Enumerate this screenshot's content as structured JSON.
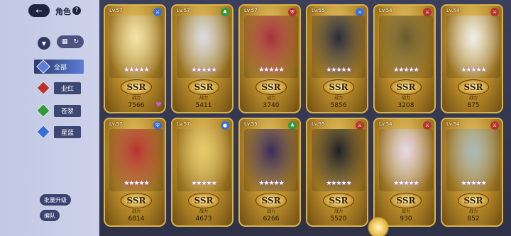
{
  "header": {
    "title": "角色",
    "help": "?",
    "back_glyph": "←"
  },
  "toolbar": {
    "filter_glyph": "▼",
    "grid_glyph": "▦",
    "refresh_glyph": "↻"
  },
  "categories": [
    {
      "label": "全部",
      "color": "#5c7ed4",
      "active": true
    },
    {
      "label": "业红",
      "color": "#b8322f",
      "active": false
    },
    {
      "label": "苍翠",
      "color": "#2f9a3a",
      "active": false
    },
    {
      "label": "星蓝",
      "color": "#3a6ed4",
      "active": false
    }
  ],
  "bottom_buttons": {
    "batch_upgrade": "批量升级",
    "formation": "编队"
  },
  "cards": [
    {
      "level": "Lv.57",
      "rarity": "SSR",
      "power_label": "战力",
      "power": "7566",
      "element_color": "#3a6ed4",
      "element_icon": "sword-icon",
      "heart": true,
      "portrait_color": "#f4e3a8"
    },
    {
      "level": "Lv.57",
      "rarity": "SSR",
      "power_label": "战力",
      "power": "5411",
      "element_color": "#2f9a3a",
      "element_icon": "leaf-icon",
      "heart": false,
      "portrait_color": "#d9dbe4"
    },
    {
      "level": "Lv.57",
      "rarity": "SSR",
      "power_label": "战力",
      "power": "3740",
      "element_color": "#b8322f",
      "element_icon": "shield-icon",
      "heart": false,
      "portrait_color": "#a8303c"
    },
    {
      "level": "Lv.55",
      "rarity": "SSR",
      "power_label": "战力",
      "power": "5856",
      "element_color": "#3a6ed4",
      "element_icon": "sword-icon",
      "heart": false,
      "portrait_color": "#2a2a3a"
    },
    {
      "level": "Lv.54",
      "rarity": "SSR",
      "power_label": "战力",
      "power": "3208",
      "element_color": "#b8322f",
      "element_icon": "sword-icon",
      "heart": false,
      "portrait_color": "#6a5a2a"
    },
    {
      "level": "Lv.54",
      "rarity": "SSR",
      "power_label": "战力",
      "power": "875",
      "element_color": "#b8322f",
      "element_icon": "sword-icon",
      "heart": false,
      "portrait_color": "#f1ede6"
    },
    {
      "level": "Lv.57",
      "rarity": "SSR",
      "power_label": "战力",
      "power": "6814",
      "element_color": "#3a6ed4",
      "element_icon": "shield-icon",
      "heart": false,
      "portrait_color": "#b8322f"
    },
    {
      "level": "Lv.57",
      "rarity": "SSR",
      "power_label": "战力",
      "power": "4673",
      "element_color": "#3a6ed4",
      "element_icon": "drop-icon",
      "heart": false,
      "portrait_color": "#e8c96a"
    },
    {
      "level": "Lv.55",
      "rarity": "SSR",
      "power_label": "战力",
      "power": "6266",
      "element_color": "#2f9a3a",
      "element_icon": "leaf-icon",
      "heart": false,
      "portrait_color": "#3a2a5a"
    },
    {
      "level": "Lv.55",
      "rarity": "SSR",
      "power_label": "战力",
      "power": "5520",
      "element_color": "#b8322f",
      "element_icon": "sword-icon",
      "heart": false,
      "portrait_color": "#1e1e24"
    },
    {
      "level": "Lv.54",
      "rarity": "SSR",
      "power_label": "战力",
      "power": "930",
      "element_color": "#b8322f",
      "element_icon": "sword-icon",
      "heart": false,
      "portrait_color": "#e6d6e6"
    },
    {
      "level": "Lv.54",
      "rarity": "SSR",
      "power_label": "战力",
      "power": "852",
      "element_color": "#b8322f",
      "element_icon": "sword-icon",
      "heart": false,
      "portrait_color": "#aab8b8"
    }
  ],
  "stars": "★★★★★"
}
